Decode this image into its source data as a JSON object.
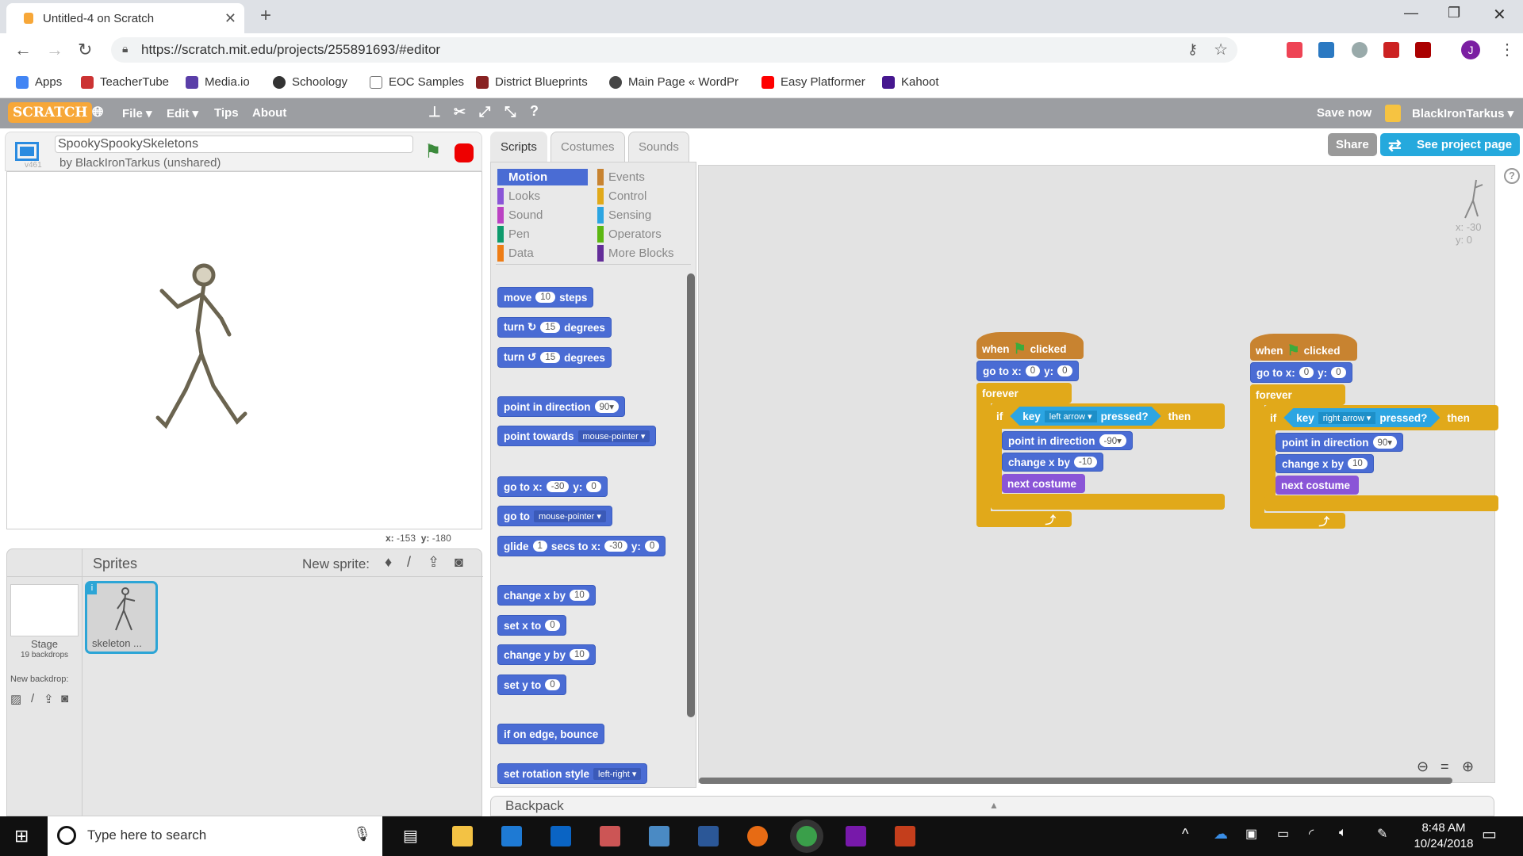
{
  "browser": {
    "tab_title": "Untitled-4 on Scratch",
    "url": "https://scratch.mit.edu/projects/255891693/#editor",
    "bookmarks": [
      "Apps",
      "TeacherTube",
      "Media.io",
      "Schoology",
      "EOC Samples",
      "District Blueprints",
      "Main Page « WordPr",
      "Easy Platformer",
      "Kahoot"
    ]
  },
  "menu": {
    "logo": "SCRATCH",
    "file": "File ▾",
    "edit": "Edit ▾",
    "tips": "Tips",
    "about": "About",
    "save_now": "Save now",
    "user": "BlackIronTarkus ▾"
  },
  "project": {
    "title": "SpookySpookySkeletons",
    "author": "by BlackIronTarkus (unshared)",
    "version": "v461",
    "share": "Share",
    "see_project_page": "See project page",
    "mouse_x_label": "x:",
    "mouse_x": "-153",
    "mouse_y_label": "y:",
    "mouse_y": "-180"
  },
  "sprites": {
    "header": "Sprites",
    "new_sprite": "New sprite:",
    "stage_label": "Stage",
    "backdrops": "19 backdrops",
    "new_backdrop": "New backdrop:",
    "items": [
      {
        "name": "skeleton ..."
      }
    ]
  },
  "tabs": [
    "Scripts",
    "Costumes",
    "Sounds"
  ],
  "categories": [
    {
      "label": "Motion",
      "color": "#4a6cd4",
      "selected": true
    },
    {
      "label": "Events",
      "color": "#c88330"
    },
    {
      "label": "Looks",
      "color": "#8a55d7"
    },
    {
      "label": "Control",
      "color": "#e1a91a"
    },
    {
      "label": "Sound",
      "color": "#bb42c3"
    },
    {
      "label": "Sensing",
      "color": "#2ca5e2"
    },
    {
      "label": "Pen",
      "color": "#0e9a6c"
    },
    {
      "label": "Operators",
      "color": "#5cb712"
    },
    {
      "label": "Data",
      "color": "#ee7d16"
    },
    {
      "label": "More Blocks",
      "color": "#632d99"
    }
  ],
  "palette": [
    [
      {
        "t": "move"
      },
      {
        "n": "10"
      },
      {
        "t": "steps"
      }
    ],
    [
      {
        "t": "turn ↻"
      },
      {
        "n": "15"
      },
      {
        "t": "degrees"
      }
    ],
    [
      {
        "t": "turn ↺"
      },
      {
        "n": "15"
      },
      {
        "t": "degrees"
      }
    ],
    [
      {
        "t": "point in direction"
      },
      {
        "n": "90▾"
      }
    ],
    [
      {
        "t": "point towards"
      },
      {
        "d": "mouse-pointer ▾"
      }
    ],
    [
      {
        "t": "go to x:"
      },
      {
        "n": "-30"
      },
      {
        "t": "y:"
      },
      {
        "n": "0"
      }
    ],
    [
      {
        "t": "go to"
      },
      {
        "d": "mouse-pointer ▾"
      }
    ],
    [
      {
        "t": "glide"
      },
      {
        "n": "1"
      },
      {
        "t": "secs to x:"
      },
      {
        "n": "-30"
      },
      {
        "t": "y:"
      },
      {
        "n": "0"
      }
    ],
    [
      {
        "t": "change x by"
      },
      {
        "n": "10"
      }
    ],
    [
      {
        "t": "set x to"
      },
      {
        "n": "0"
      }
    ],
    [
      {
        "t": "change y by"
      },
      {
        "n": "10"
      }
    ],
    [
      {
        "t": "set y to"
      },
      {
        "n": "0"
      }
    ],
    [
      {
        "t": "if on edge, bounce"
      }
    ],
    [
      {
        "t": "set rotation style"
      },
      {
        "d": "left-right ▾"
      }
    ]
  ],
  "scripts": [
    {
      "when": "when",
      "clicked": "clicked",
      "goto": "go to x:",
      "x": "0",
      "y_label": "y:",
      "y": "0",
      "forever": "forever",
      "if": "if",
      "key": "key",
      "key_value": "left arrow ▾",
      "pressed": "pressed?",
      "then": "then",
      "point": "point in direction",
      "direction": "-90▾",
      "change": "change x by",
      "change_value": "-10",
      "next": "next costume"
    },
    {
      "when": "when",
      "clicked": "clicked",
      "goto": "go to x:",
      "x": "0",
      "y_label": "y:",
      "y": "0",
      "forever": "forever",
      "if": "if",
      "key": "key",
      "key_value": "right arrow ▾",
      "pressed": "pressed?",
      "then": "then",
      "point": "point in direction",
      "direction": "90▾",
      "change": "change x by",
      "change_value": "10",
      "next": "next costume"
    }
  ],
  "sprite_info": {
    "x": "x: -30",
    "y": "y: 0"
  },
  "backpack": "Backpack",
  "taskbar": {
    "search_placeholder": "Type here to search",
    "time": "8:48 AM",
    "date": "10/24/2018"
  }
}
